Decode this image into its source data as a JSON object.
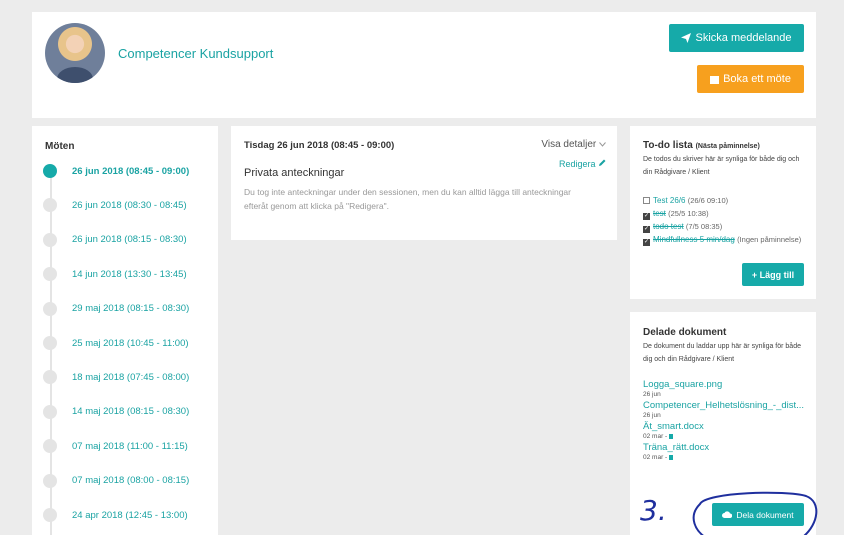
{
  "header": {
    "org_name": "Competencer Kundsupport",
    "message_button": "Skicka meddelande",
    "meeting_button": "Boka ett möte"
  },
  "meetings": {
    "title": "Möten",
    "items": [
      {
        "label": "26 jun 2018 (08:45 - 09:00)",
        "active": true
      },
      {
        "label": "26 jun 2018 (08:30 - 08:45)"
      },
      {
        "label": "26 jun 2018 (08:15 - 08:30)"
      },
      {
        "label": "14 jun 2018 (13:30 - 13:45)"
      },
      {
        "label": "29 maj 2018 (08:15 - 08:30)"
      },
      {
        "label": "25 maj 2018 (10:45 - 11:00)"
      },
      {
        "label": "18 maj 2018 (07:45 - 08:00)"
      },
      {
        "label": "14 maj 2018 (08:15 - 08:30)"
      },
      {
        "label": "07 maj 2018 (11:00 - 11:15)"
      },
      {
        "label": "07 maj 2018 (08:00 - 08:15)"
      },
      {
        "label": "24 apr 2018 (12:45 - 13:00)"
      }
    ]
  },
  "notes": {
    "date_title": "Tisdag 26 jun 2018 (08:45 - 09:00)",
    "toggle": "Visa detaljer",
    "edit": "Redigera",
    "heading": "Privata anteckningar",
    "body": "Du tog inte anteckningar under den sessionen, men du kan alltid lägga till anteckningar efteråt genom att klicka på \"Redigera\"."
  },
  "todo": {
    "title": "To-do lista",
    "subtitle": "(Nästa påminnelse)",
    "description": "De todos du skriver här är synliga för både dig och din Rådgivare / Klient",
    "items": [
      {
        "text": "Test 26/6",
        "meta": "(26/6 09:10)",
        "done": false
      },
      {
        "text": "test",
        "meta": "(25/5 10:38)",
        "done": true
      },
      {
        "text": "todo test",
        "meta": "(7/5 08:35)",
        "done": true
      },
      {
        "text": "Mindfullness 5 min/dag",
        "meta": "(Ingen påminnelse)",
        "done": true
      }
    ],
    "add_button": "+ Lägg till"
  },
  "docs": {
    "title": "Delade dokument",
    "description": "De dokument du laddar upp här är synliga för både dig och din Rådgivare / Klient",
    "items": [
      {
        "name": "Logga_square.png",
        "date": "26 jun",
        "trash": false
      },
      {
        "name": "Competencer_Helhetslösning_-_dist...",
        "date": "26 jun",
        "trash": false
      },
      {
        "name": "Ät_smart.docx",
        "date": "02 mar -",
        "trash": true
      },
      {
        "name": "Träna_rätt.docx",
        "date": "02 mar -",
        "trash": true
      }
    ],
    "share_button": "Dela dokument"
  },
  "annotation": {
    "mark": "3.",
    "color": "#1f2f9e"
  }
}
